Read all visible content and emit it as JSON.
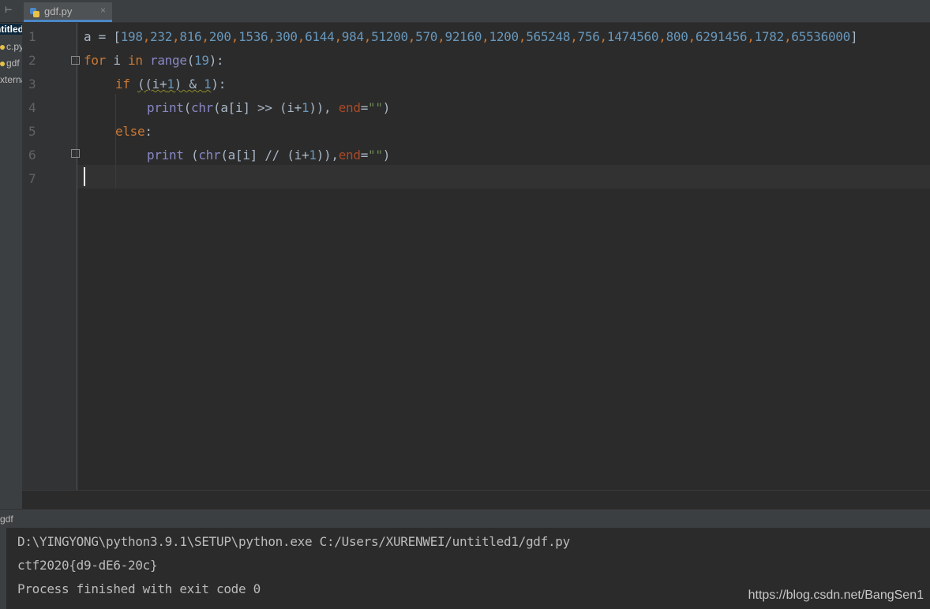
{
  "project": {
    "collapse_glyph": "⊢",
    "items": [
      "ntitled",
      "c.py",
      "gdf",
      "xterna"
    ]
  },
  "tab": {
    "filename": "gdf.py",
    "close": "×"
  },
  "editor": {
    "line_numbers": [
      "1",
      "2",
      "3",
      "4",
      "5",
      "6",
      "7"
    ],
    "line1": {
      "a": "a",
      "eq": " = ",
      "open": "[",
      "nums": [
        "198",
        "232",
        "816",
        "200",
        "1536",
        "300",
        "6144",
        "984",
        "51200",
        "570",
        "92160",
        "1200",
        "565248",
        "756",
        "1474560",
        "800",
        "6291456",
        "1782",
        "65536000"
      ],
      "sep": ",",
      "close": "]"
    },
    "line2": {
      "for": "for",
      "var": " i ",
      "in": "in",
      "sp": " ",
      "range": "range",
      "po": "(",
      "n": "19",
      "pc": "):"
    },
    "line3": {
      "if": "if",
      "sp": " ",
      "cond_a": "((i+",
      "one": "1",
      "cond_b": ") & ",
      "one2": "1",
      "end": "):"
    },
    "line4": {
      "print": "print",
      "a": "(",
      "chr": "chr",
      "b": "(a[i] >> (i+",
      "one": "1",
      "c": ")), ",
      "end": "end",
      "eq": "=",
      "str": "\"\"",
      "close": ")"
    },
    "line5": {
      "else": "else",
      "colon": ":"
    },
    "line6": {
      "print": "print",
      "a": " (",
      "chr": "chr",
      "b": "(a[i] // (i+",
      "one": "1",
      "c": ")),",
      "end": "end",
      "eq": "=",
      "str": "\"\"",
      "close": ")"
    }
  },
  "run": {
    "tab_label": "gdf",
    "lines": [
      "D:\\YINGYONG\\python3.9.1\\SETUP\\python.exe C:/Users/XURENWEI/untitled1/gdf.py",
      "ctf2020{d9-dE6-20c}",
      "Process finished with exit code 0"
    ],
    "watermark": "https://blog.csdn.net/BangSen1"
  },
  "colors": {
    "background": "#2b2b2b",
    "keyword": "#cc7832",
    "number": "#6897bb",
    "builtin": "#8888c6",
    "string": "#6a8759",
    "param": "#aa4926",
    "text": "#a9b7c6"
  },
  "icons": [
    "python-file-icon",
    "fold-icon",
    "collapse-icon",
    "close-icon"
  ]
}
